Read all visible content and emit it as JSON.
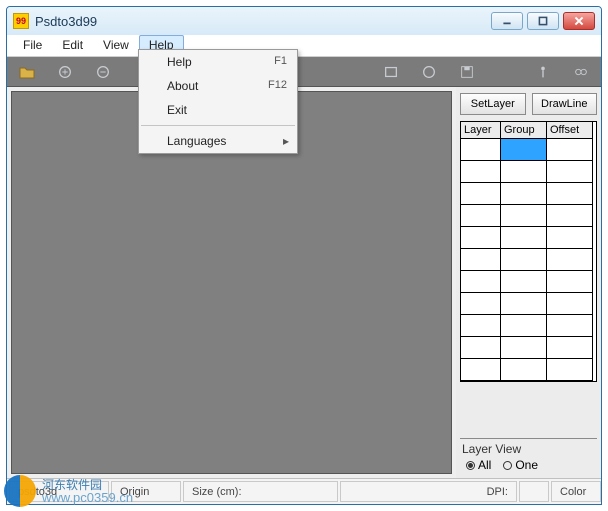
{
  "window": {
    "title": "Psdto3d99"
  },
  "menubar": {
    "file": "File",
    "edit": "Edit",
    "view": "View",
    "help": "Help"
  },
  "help_menu": {
    "help": {
      "label": "Help",
      "shortcut": "F1"
    },
    "about": {
      "label": "About",
      "shortcut": "F12"
    },
    "exit": {
      "label": "Exit"
    },
    "languages": {
      "label": "Languages"
    }
  },
  "right_panel": {
    "setlayer": "SetLayer",
    "drawline": "DrawLine",
    "headers": {
      "layer": "Layer",
      "group": "Group",
      "offset": "Offset"
    },
    "layer_view": {
      "title": "Layer View",
      "all": "All",
      "one": "One"
    }
  },
  "statusbar": {
    "file": "psdto3d",
    "origin_label": "Origin",
    "size_label": "Size (cm):",
    "dpi_label": "DPI:",
    "color_label": "Color"
  },
  "watermark": {
    "text": "河东软件园",
    "url": "www.pc0359.cn"
  }
}
